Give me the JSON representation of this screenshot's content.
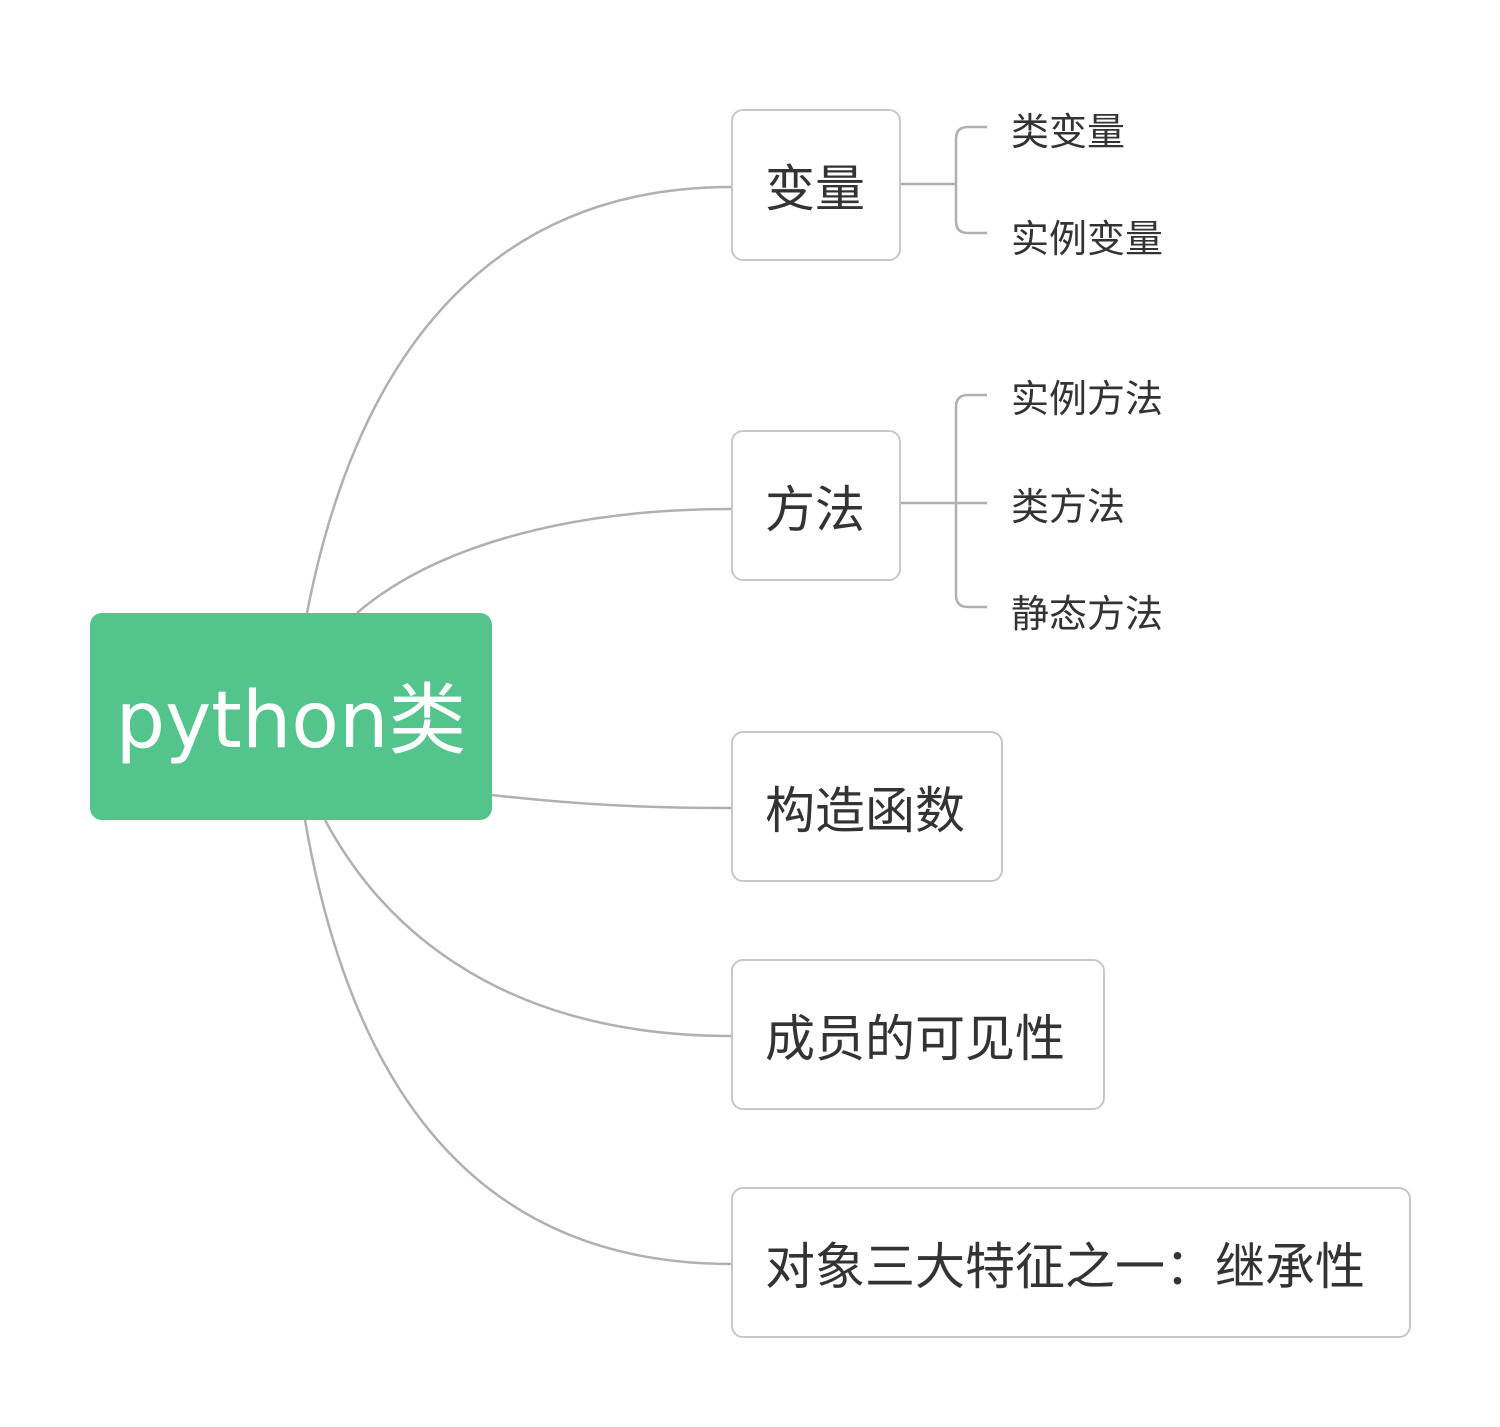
{
  "colors": {
    "root_fill": "#52c48c",
    "root_text": "#ffffff",
    "topic_border": "#c7c7c7",
    "connector": "#b0b0b0",
    "text": "#333333"
  },
  "root": {
    "label": "python类"
  },
  "topics": [
    {
      "label": "变量",
      "subtopics": [
        "类变量",
        "实例变量"
      ]
    },
    {
      "label": "方法",
      "subtopics": [
        "实例方法",
        "类方法",
        "静态方法"
      ]
    },
    {
      "label": "构造函数",
      "subtopics": []
    },
    {
      "label": "成员的可见性",
      "subtopics": []
    },
    {
      "label": "对象三大特征之一：继承性",
      "subtopics": []
    }
  ]
}
